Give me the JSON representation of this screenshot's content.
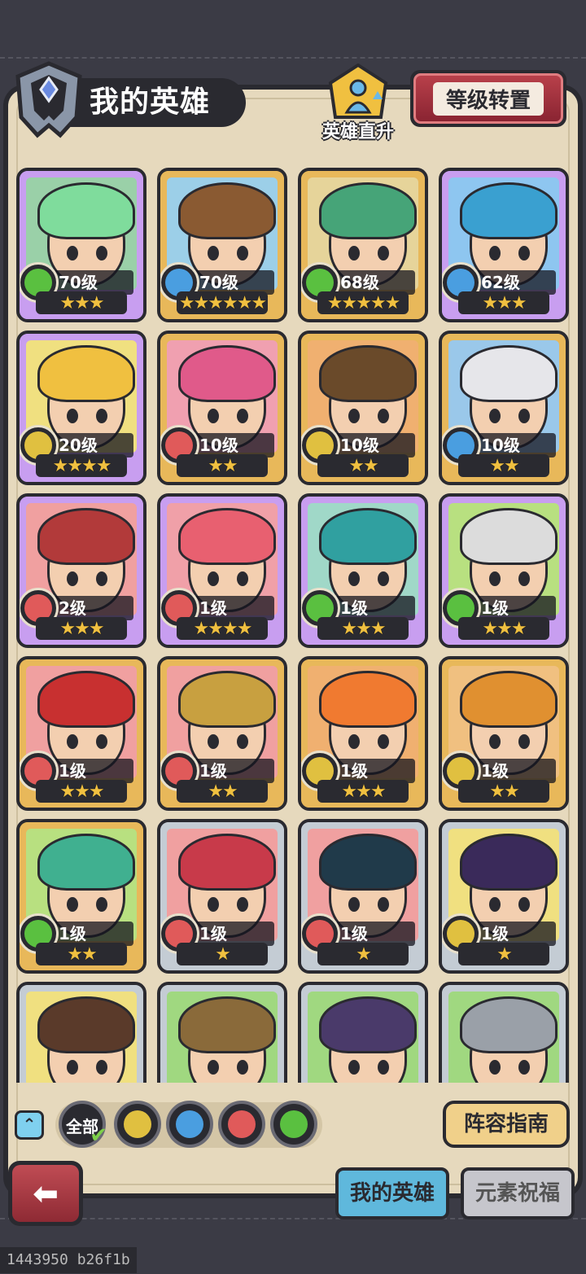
{
  "header": {
    "title": "我的英雄",
    "promote_label": "英雄直升",
    "level_reset_label": "等级转置"
  },
  "colors": {
    "fire": "#e05a5a",
    "water": "#4a9ee0",
    "wind": "#5ac040",
    "earth": "#e0c040",
    "star": "#f0c040"
  },
  "heroes": [
    {
      "level": "70级",
      "element": "wind",
      "stars": "★★★",
      "frame": "purple",
      "bg": "#9ad0a8",
      "hair": "#7fdc9c"
    },
    {
      "level": "70级",
      "element": "water",
      "stars": "★★★★★★",
      "frame": "gold",
      "bg": "#9ccfe8",
      "hair": "#8a5a32"
    },
    {
      "level": "68级",
      "element": "wind",
      "stars": "★★★★★",
      "frame": "gold",
      "bg": "#e6d49a",
      "hair": "#46a478"
    },
    {
      "level": "62级",
      "element": "water",
      "stars": "★★★",
      "frame": "purple",
      "bg": "#8ec6f0",
      "hair": "#3aa0d0"
    },
    {
      "level": "20级",
      "element": "earth",
      "stars": "★★★★",
      "frame": "purple",
      "bg": "#f0e080",
      "hair": "#f0c040"
    },
    {
      "level": "10级",
      "element": "fire",
      "stars": "★★",
      "frame": "gold",
      "bg": "#f0a0b0",
      "hair": "#e05a8a"
    },
    {
      "level": "10级",
      "element": "earth",
      "stars": "★★",
      "frame": "gold",
      "bg": "#f0b070",
      "hair": "#6a4a2a"
    },
    {
      "level": "10级",
      "element": "water",
      "stars": "★★",
      "frame": "gold",
      "bg": "#9ac8ea",
      "hair": "#e6e6ea"
    },
    {
      "level": "2级",
      "element": "fire",
      "stars": "★★★",
      "frame": "purple",
      "bg": "#f0a0a0",
      "hair": "#b23a3a"
    },
    {
      "level": "1级",
      "element": "fire",
      "stars": "★★★★",
      "frame": "purple",
      "bg": "#f0a0a8",
      "hair": "#e86070"
    },
    {
      "level": "1级",
      "element": "wind",
      "stars": "★★★",
      "frame": "purple",
      "bg": "#a0d8c8",
      "hair": "#30a0a0"
    },
    {
      "level": "1级",
      "element": "wind",
      "stars": "★★★",
      "frame": "purple",
      "bg": "#b8e080",
      "hair": "#dcdcdc"
    },
    {
      "level": "1级",
      "element": "fire",
      "stars": "★★★",
      "frame": "gold",
      "bg": "#f0a0a0",
      "hair": "#c83030"
    },
    {
      "level": "1级",
      "element": "fire",
      "stars": "★★",
      "frame": "gold",
      "bg": "#f0a0a0",
      "hair": "#c8a040"
    },
    {
      "level": "1级",
      "element": "earth",
      "stars": "★★★",
      "frame": "gold",
      "bg": "#f0b070",
      "hair": "#f07a30"
    },
    {
      "level": "1级",
      "element": "earth",
      "stars": "★★",
      "frame": "gold",
      "bg": "#f0c080",
      "hair": "#e09030"
    },
    {
      "level": "1级",
      "element": "wind",
      "stars": "★★",
      "frame": "gold",
      "bg": "#b8e080",
      "hair": "#40b090"
    },
    {
      "level": "1级",
      "element": "fire",
      "stars": "★",
      "frame": "silver",
      "bg": "#f0a0a0",
      "hair": "#c83a4a"
    },
    {
      "level": "1级",
      "element": "fire",
      "stars": "★",
      "frame": "silver",
      "bg": "#f0a0a0",
      "hair": "#203a4a"
    },
    {
      "level": "1级",
      "element": "earth",
      "stars": "★",
      "frame": "silver",
      "bg": "#f0e080",
      "hair": "#3a2a5a"
    },
    {
      "level": "",
      "element": "",
      "stars": "",
      "frame": "silver",
      "bg": "#f0e080",
      "hair": "#5a3a2a"
    },
    {
      "level": "",
      "element": "",
      "stars": "",
      "frame": "silver",
      "bg": "#a0d880",
      "hair": "#8a6a3a"
    },
    {
      "level": "",
      "element": "",
      "stars": "",
      "frame": "silver",
      "bg": "#a0d880",
      "hair": "#4a3a6a"
    },
    {
      "level": "",
      "element": "",
      "stars": "",
      "frame": "silver",
      "bg": "#a0d880",
      "hair": "#9aa0a8"
    }
  ],
  "filters": {
    "all_label": "全部",
    "items": [
      "earth",
      "water",
      "fire",
      "wind"
    ]
  },
  "guide_label": "阵容指南",
  "tabs": {
    "my_heroes": "我的英雄",
    "element_blessing": "元素祝福"
  },
  "watermark": "1443950 b26f1b"
}
